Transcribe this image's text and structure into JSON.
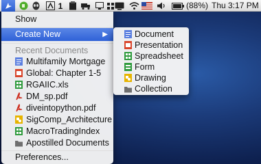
{
  "menubar": {
    "status_text": "(88%)",
    "clock": "Thu 3:17 PM",
    "icons": [
      "app-launcher-icon",
      "evernote-icon",
      "alien-icon",
      "adobe-icon",
      "one-icon",
      "clipboard-icon",
      "truck-icon",
      "monitor-icon",
      "grid-icon",
      "tv-icon",
      "wifi-icon",
      "flag-us-icon",
      "volume-icon",
      "battery-icon"
    ]
  },
  "menu": {
    "show_label": "Show",
    "create_new_label": "Create New",
    "recent_header": "Recent Documents",
    "recent": [
      {
        "label": "Multifamily Mortgage",
        "icon": "document-icon"
      },
      {
        "label": "Global: Chapter 1-5",
        "icon": "presentation-icon"
      },
      {
        "label": "RGAIIC.xls",
        "icon": "spreadsheet-icon"
      },
      {
        "label": "DM_sp.pdf",
        "icon": "pdf-icon"
      },
      {
        "label": "diveintopython.pdf",
        "icon": "pdf-icon"
      },
      {
        "label": "SigComp_Architecture",
        "icon": "drawing-icon"
      },
      {
        "label": "MacroTradingIndex",
        "icon": "spreadsheet-icon"
      },
      {
        "label": "Apostilled Documents",
        "icon": "collection-icon"
      }
    ],
    "preferences_label": "Preferences..."
  },
  "submenu": {
    "items": [
      {
        "label": "Document",
        "icon": "document-icon"
      },
      {
        "label": "Presentation",
        "icon": "presentation-icon"
      },
      {
        "label": "Spreadsheet",
        "icon": "spreadsheet-icon"
      },
      {
        "label": "Form",
        "icon": "form-icon"
      },
      {
        "label": "Drawing",
        "icon": "drawing-icon"
      },
      {
        "label": "Collection",
        "icon": "collection-icon"
      }
    ]
  },
  "colors": {
    "highlight": "#2f62d7",
    "document": "#5b7fe0",
    "presentation": "#d9452b",
    "spreadsheet": "#2e9a3c",
    "form": "#2e9a3c",
    "drawing": "#e7b400",
    "pdf": "#cc2a1b",
    "collection": "#6f6f6f"
  }
}
